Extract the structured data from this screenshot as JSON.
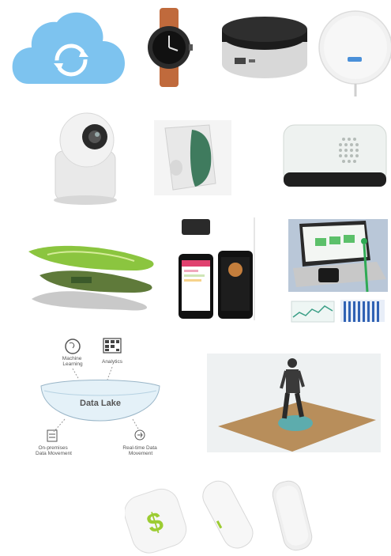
{
  "tiles": [
    {
      "name": "cloud-sync",
      "icon": "cloud-sync-icon",
      "color": "#7dc3ef"
    },
    {
      "name": "smartwatch",
      "icon": "smartwatch-icon",
      "strap_color": "#c06a3c"
    },
    {
      "name": "smart-hub",
      "icon": "smart-hub-icon"
    },
    {
      "name": "wireless-charger",
      "icon": "charger-puck-icon"
    },
    {
      "name": "security-camera",
      "icon": "security-camera-icon"
    },
    {
      "name": "motion-sensor",
      "icon": "motion-sensor-icon",
      "accent": "#3f7b5e"
    },
    {
      "name": "smart-speaker",
      "icon": "speaker-icon"
    },
    {
      "name": "sensor-insoles",
      "icon": "insole-icon",
      "accent": "#8bc53f"
    },
    {
      "name": "mobile-app-phones",
      "icon": "smartphone-icon",
      "accent": "#e0416f"
    },
    {
      "name": "laptop-dashboard",
      "icon": "laptop-icon"
    },
    {
      "name": "person-on-sensor-floor",
      "icon": "walking-person-icon",
      "floor_color": "#b88e5b"
    },
    {
      "name": "wearable-tags",
      "icon": "wearable-tag-icon",
      "accent": "#9ccc32"
    }
  ],
  "diagram": {
    "machine_learning": "Machine\nLearning",
    "analytics": "Analytics",
    "data_lake": "Data Lake",
    "on_premises": "On-premises\nData Movement",
    "real_time": "Real-time Data\nMovement"
  },
  "phone": {
    "tag_letter": "$"
  }
}
